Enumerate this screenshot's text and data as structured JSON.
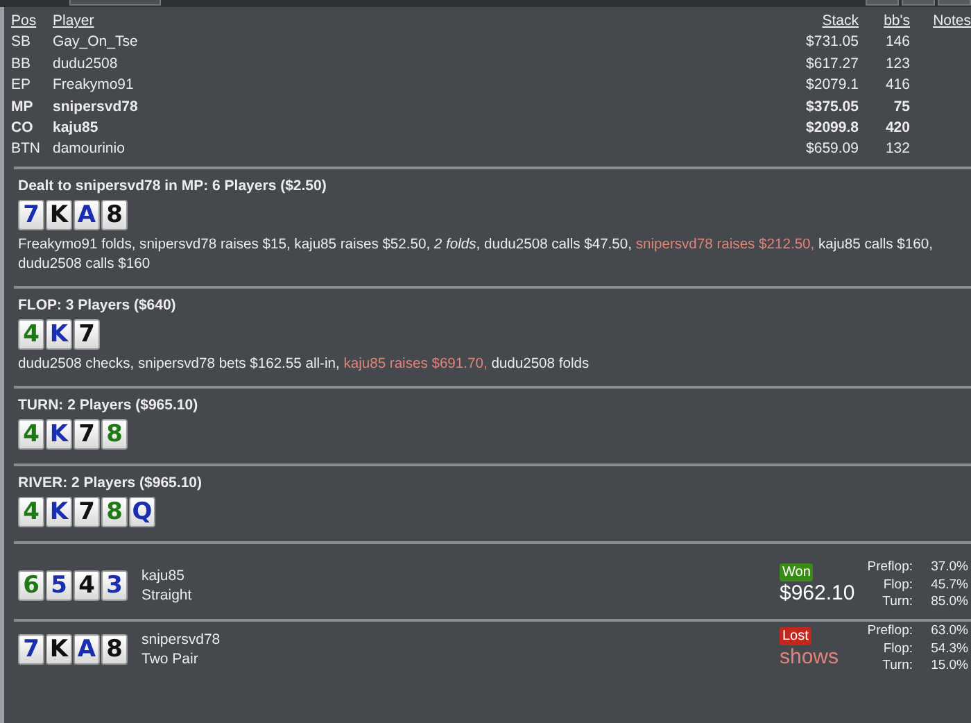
{
  "players": {
    "columns": [
      "Pos",
      "Player",
      "Stack",
      "bb's",
      "Notes"
    ],
    "rows": [
      {
        "pos": "SB",
        "player": "Gay_On_Tse",
        "stack": "$731.05",
        "bbs": "146",
        "bold": false
      },
      {
        "pos": "BB",
        "player": "dudu2508",
        "stack": "$617.27",
        "bbs": "123",
        "bold": false
      },
      {
        "pos": "EP",
        "player": "Freakymo91",
        "stack": "$2079.1",
        "bbs": "416",
        "bold": false
      },
      {
        "pos": "MP",
        "player": "snipersvd78",
        "stack": "$375.05",
        "bbs": "75",
        "bold": true
      },
      {
        "pos": "CO",
        "player": "kaju85",
        "stack": "$2099.8",
        "bbs": "420",
        "bold": true
      },
      {
        "pos": "BTN",
        "player": "damourinio",
        "stack": "$659.09",
        "bbs": "132",
        "bold": false
      }
    ]
  },
  "streets": [
    {
      "title": "Dealt to snipersvd78 in MP: 6 Players ($2.50)",
      "cards": [
        {
          "rank": "7",
          "color": "#1a2fb0"
        },
        {
          "rank": "K",
          "color": "#111111"
        },
        {
          "rank": "A",
          "color": "#1a2fb0"
        },
        {
          "rank": "8",
          "color": "#111111"
        }
      ],
      "actions": [
        {
          "text": "Freakymo91 folds, snipersvd78 raises $15, kaju85 raises $52.50, ",
          "kind": "plain"
        },
        {
          "text": "2 folds",
          "kind": "italic"
        },
        {
          "text": ", dudu2508 calls $47.50, ",
          "kind": "plain"
        },
        {
          "text": "snipersvd78 raises $212.50,",
          "kind": "hero"
        },
        {
          "text": " kaju85 calls $160, dudu2508 calls $160",
          "kind": "plain"
        }
      ]
    },
    {
      "title": "FLOP: 3 Players ($640)",
      "cards": [
        {
          "rank": "4",
          "color": "#1f7a16"
        },
        {
          "rank": "K",
          "color": "#1a2fb0"
        },
        {
          "rank": "7",
          "color": "#111111"
        }
      ],
      "actions": [
        {
          "text": "dudu2508 checks, snipersvd78 bets $162.55 all-in, ",
          "kind": "plain"
        },
        {
          "text": "kaju85 raises $691.70,",
          "kind": "hero"
        },
        {
          "text": " dudu2508 folds",
          "kind": "plain"
        }
      ]
    },
    {
      "title": "TURN: 2 Players ($965.10)",
      "cards": [
        {
          "rank": "4",
          "color": "#1f7a16"
        },
        {
          "rank": "K",
          "color": "#1a2fb0"
        },
        {
          "rank": "7",
          "color": "#111111"
        },
        {
          "rank": "8",
          "color": "#1f7a16"
        }
      ]
    },
    {
      "title": "RIVER: 2 Players ($965.10)",
      "cards": [
        {
          "rank": "4",
          "color": "#1f7a16"
        },
        {
          "rank": "K",
          "color": "#1a2fb0"
        },
        {
          "rank": "7",
          "color": "#111111"
        },
        {
          "rank": "8",
          "color": "#1f7a16"
        },
        {
          "rank": "Q",
          "color": "#1a2fb0"
        }
      ]
    }
  ],
  "results": [
    {
      "cards": [
        {
          "rank": "6",
          "color": "#1f7a16"
        },
        {
          "rank": "5",
          "color": "#1a2fb0"
        },
        {
          "rank": "4",
          "color": "#111111"
        },
        {
          "rank": "3",
          "color": "#1a2fb0"
        }
      ],
      "player": "kaju85",
      "hand": "Straight",
      "won": true,
      "badge": "Won",
      "amount": "$962.10",
      "equity": [
        {
          "label": "Preflop:",
          "value": "37.0%"
        },
        {
          "label": "Flop:",
          "value": "45.7%"
        },
        {
          "label": "Turn:",
          "value": "85.0%"
        }
      ]
    },
    {
      "cards": [
        {
          "rank": "7",
          "color": "#1a2fb0"
        },
        {
          "rank": "K",
          "color": "#111111"
        },
        {
          "rank": "A",
          "color": "#1a2fb0"
        },
        {
          "rank": "8",
          "color": "#111111"
        }
      ],
      "player": "snipersvd78",
      "hand": "Two Pair",
      "won": false,
      "badge": "Lost",
      "amount": "shows",
      "equity": [
        {
          "label": "Preflop:",
          "value": "63.0%"
        },
        {
          "label": "Flop:",
          "value": "54.3%"
        },
        {
          "label": "Turn:",
          "value": "15.0%"
        }
      ]
    }
  ]
}
